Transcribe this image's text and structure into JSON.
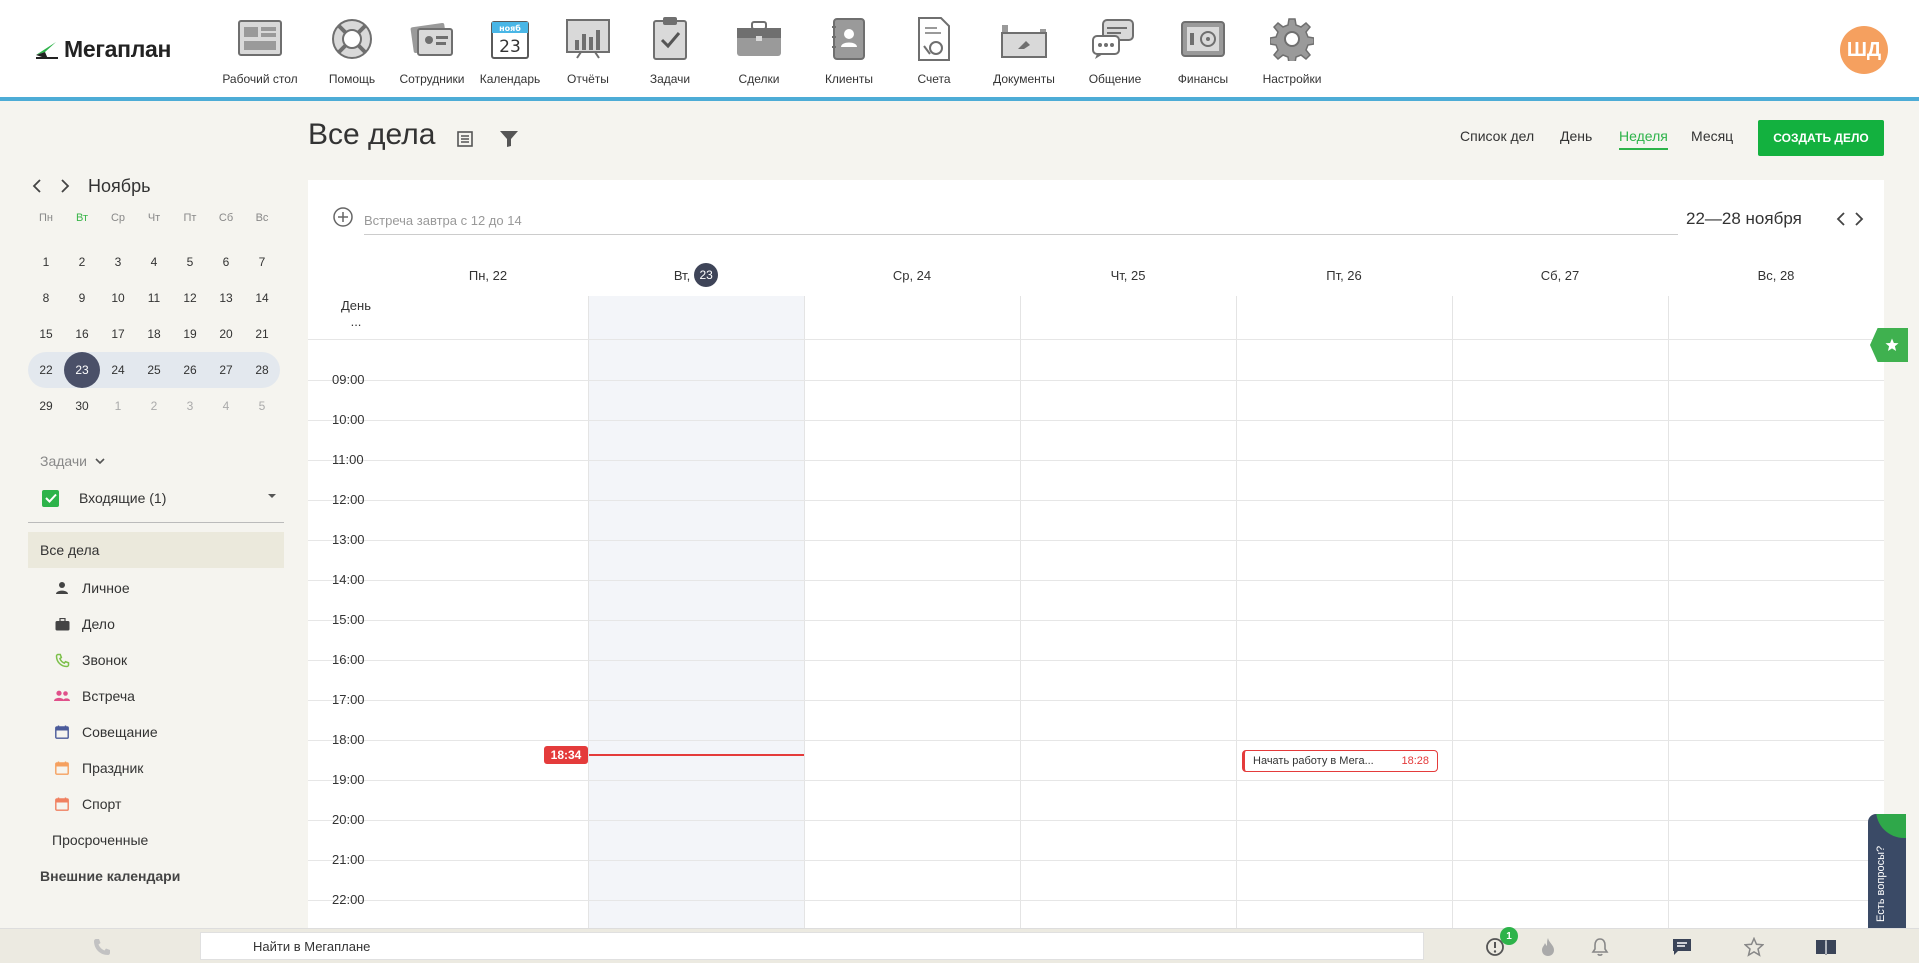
{
  "app": {
    "logo_text": "Мегаплан",
    "avatar_initials": "ШД",
    "brand_color": "#13b13f",
    "accent_color": "#4dacd6"
  },
  "nav": [
    {
      "label": "Рабочий стол",
      "icon": "desktop-icon"
    },
    {
      "label": "Помощь",
      "icon": "lifebuoy-icon"
    },
    {
      "label": "Сотрудники",
      "icon": "employees-icon"
    },
    {
      "label": "Календарь",
      "icon": "calendar-icon",
      "icon_month": "нояб",
      "icon_day": "23"
    },
    {
      "label": "Отчёты",
      "icon": "reports-icon"
    },
    {
      "label": "Задачи",
      "icon": "tasks-icon"
    },
    {
      "label": "Сделки",
      "icon": "deals-icon"
    },
    {
      "label": "Клиенты",
      "icon": "clients-icon"
    },
    {
      "label": "Счета",
      "icon": "invoices-icon"
    },
    {
      "label": "Документы",
      "icon": "documents-icon"
    },
    {
      "label": "Общение",
      "icon": "chat-icon"
    },
    {
      "label": "Финансы",
      "icon": "finance-icon"
    },
    {
      "label": "Настройки",
      "icon": "settings-icon"
    }
  ],
  "header": {
    "title": "Все дела",
    "views": [
      "Список дел",
      "День",
      "Неделя",
      "Месяц"
    ],
    "active_view": "Неделя",
    "create_button": "СОЗДАТЬ ДЕЛО"
  },
  "mini_calendar": {
    "month": "Ноябрь",
    "weekdays": [
      "Пн",
      "Вт",
      "Ср",
      "Чт",
      "Пт",
      "Сб",
      "Вс"
    ],
    "weeks": [
      [
        "1",
        "2",
        "3",
        "4",
        "5",
        "6",
        "7"
      ],
      [
        "8",
        "9",
        "10",
        "11",
        "12",
        "13",
        "14"
      ],
      [
        "15",
        "16",
        "17",
        "18",
        "19",
        "20",
        "21"
      ],
      [
        "22",
        "23",
        "24",
        "25",
        "26",
        "27",
        "28"
      ],
      [
        "29",
        "30",
        "1",
        "2",
        "3",
        "4",
        "5"
      ]
    ],
    "today": "23"
  },
  "sidebar": {
    "tasks_label": "Задачи",
    "inbox_label": "Входящие (1)",
    "all_deals": "Все дела",
    "categories": [
      {
        "label": "Личное",
        "icon": "person-icon",
        "color": "#444444"
      },
      {
        "label": "Дело",
        "icon": "briefcase-icon",
        "color": "#444444"
      },
      {
        "label": "Звонок",
        "icon": "phone-icon",
        "color": "#7cc04a"
      },
      {
        "label": "Встреча",
        "icon": "people-icon",
        "color": "#e0508a"
      },
      {
        "label": "Совещание",
        "icon": "calendar-icon",
        "color": "#4a5a9a"
      },
      {
        "label": "Праздник",
        "icon": "calendar-icon",
        "color": "#f5a05f"
      },
      {
        "label": "Спорт",
        "icon": "calendar-icon",
        "color": "#f08060"
      }
    ],
    "overdue": "Просроченные",
    "external": "Внешние календари"
  },
  "calendar": {
    "quick_add_placeholder": "Встреча завтра с 12 до 14",
    "range": "22—28 ноября",
    "days": [
      {
        "label": "Пн, 22"
      },
      {
        "label": "Вт,",
        "badge": "23"
      },
      {
        "label": "Ср, 24"
      },
      {
        "label": "Чт, 25"
      },
      {
        "label": "Пт, 26"
      },
      {
        "label": "Сб, 27"
      },
      {
        "label": "Вс, 28"
      }
    ],
    "allday_label": "День",
    "allday_more": "...",
    "hours": [
      "09:00",
      "10:00",
      "11:00",
      "12:00",
      "13:00",
      "14:00",
      "15:00",
      "16:00",
      "17:00",
      "18:00",
      "19:00",
      "20:00",
      "21:00",
      "22:00"
    ],
    "now_time": "18:34",
    "event": {
      "title": "Начать работу в Мега...",
      "time": "18:28"
    }
  },
  "help_tab": "Есть вопросы?",
  "bottom": {
    "search_placeholder": "Найти в Мегаплане",
    "notif_count": "1"
  }
}
